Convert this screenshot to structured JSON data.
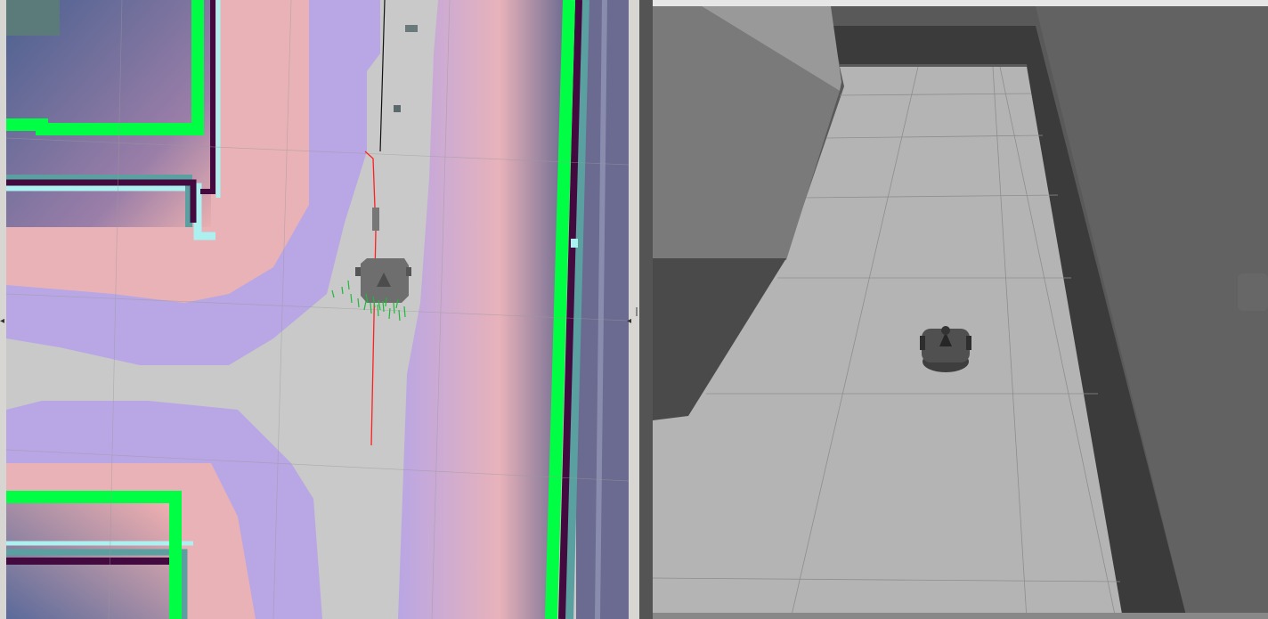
{
  "colors": {
    "free_space": "#c9c9c9",
    "inflation_inner": "#b9a6e4",
    "inflation_outer": "#f3b5b0",
    "obstacle_lethal": "#00ff44",
    "inscribed": "#420a3e",
    "inscribed_edge": "#5aa0a0",
    "unknown": "#adf0f0",
    "plan": "#ff2020",
    "particles": "#1fb93a",
    "floor_tile": "#b4b4b4",
    "wall": "#3b3b3b",
    "sky": "#595959"
  },
  "panels": {
    "map_view": {
      "name": "rviz-map-view"
    },
    "sim_view": {
      "name": "gazebo-3d-view"
    }
  },
  "icons": {
    "left_collapse": "triangle-left-icon",
    "right_collapse": "triangle-left-icon",
    "splitter": "splitter-grip-icon"
  }
}
